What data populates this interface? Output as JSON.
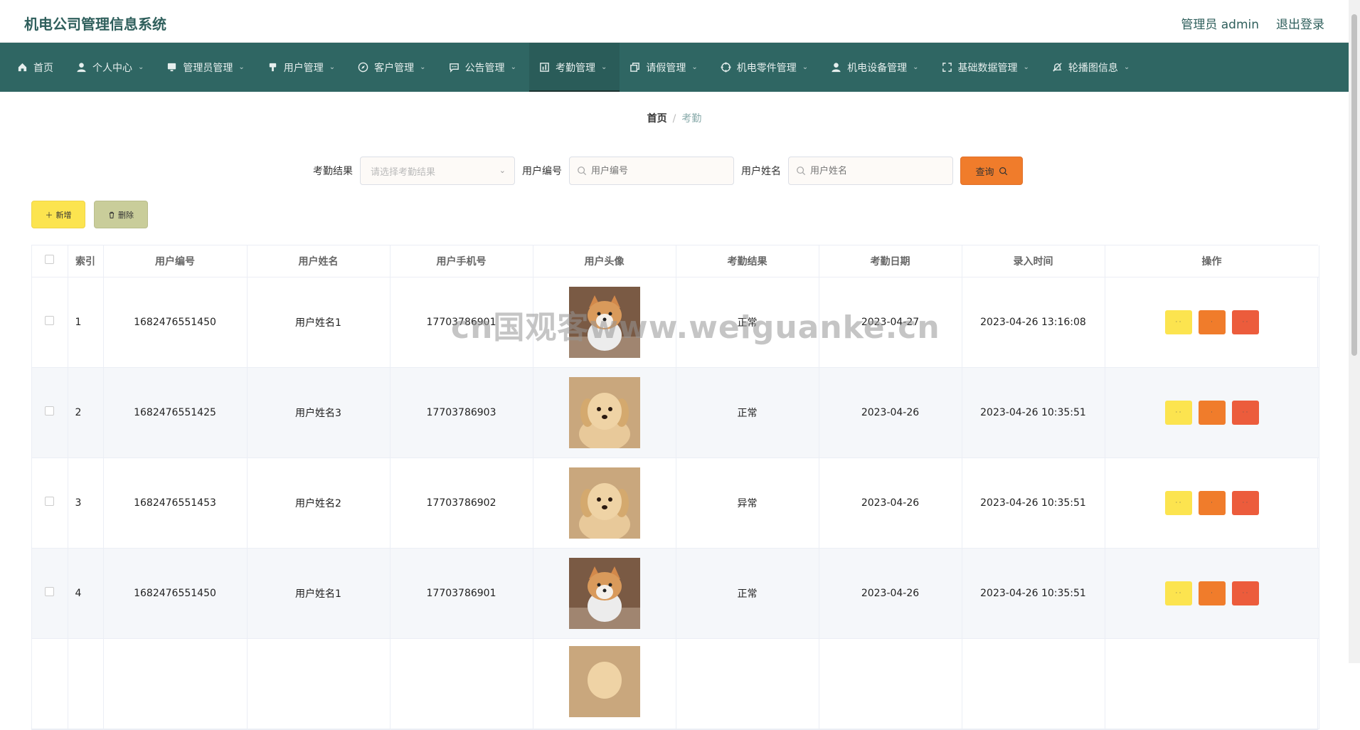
{
  "app": {
    "title": "机电公司管理信息系统",
    "user_label": "管理员 admin",
    "logout_label": "退出登录"
  },
  "nav": {
    "items": [
      {
        "label": "首页",
        "icon": "home-icon"
      },
      {
        "label": "个人中心",
        "icon": "user-icon"
      },
      {
        "label": "管理员管理",
        "icon": "monitor-icon"
      },
      {
        "label": "用户管理",
        "icon": "brush-icon"
      },
      {
        "label": "客户管理",
        "icon": "compass-icon"
      },
      {
        "label": "公告管理",
        "icon": "chat-icon"
      },
      {
        "label": "考勤管理",
        "icon": "chart-icon"
      },
      {
        "label": "请假管理",
        "icon": "copy-icon"
      },
      {
        "label": "机电零件管理",
        "icon": "target-icon"
      },
      {
        "label": "机电设备管理",
        "icon": "person-icon"
      },
      {
        "label": "基础数据管理",
        "icon": "fullscreen-icon"
      },
      {
        "label": "轮播图信息",
        "icon": "bell-off-icon"
      }
    ]
  },
  "breadcrumb": {
    "home": "首页",
    "current": "考勤"
  },
  "search": {
    "result_label": "考勤结果",
    "result_placeholder": "请选择考勤结果",
    "user_no_label": "用户编号",
    "user_no_placeholder": "用户编号",
    "user_name_label": "用户姓名",
    "user_name_placeholder": "用户姓名",
    "query_label": "查询"
  },
  "actions": {
    "add_label": "新增",
    "delete_label": "删除"
  },
  "table": {
    "headers": [
      "索引",
      "用户编号",
      "用户姓名",
      "用户手机号",
      "用户头像",
      "考勤结果",
      "考勤日期",
      "录入时间",
      "操作"
    ],
    "rows": [
      {
        "index": "1",
        "user_no": "1682476551450",
        "name": "用户姓名1",
        "phone": "17703786901",
        "avatar": "shiba",
        "result": "正常",
        "date": "2023-04-27",
        "created": "2023-04-26 13:16:08"
      },
      {
        "index": "2",
        "user_no": "1682476551425",
        "name": "用户姓名3",
        "phone": "17703786903",
        "avatar": "puppy",
        "result": "正常",
        "date": "2023-04-26",
        "created": "2023-04-26 10:35:51"
      },
      {
        "index": "3",
        "user_no": "1682476551453",
        "name": "用户姓名2",
        "phone": "17703786902",
        "avatar": "puppy",
        "result": "异常",
        "date": "2023-04-26",
        "created": "2023-04-26 10:35:51"
      },
      {
        "index": "4",
        "user_no": "1682476551450",
        "name": "用户姓名1",
        "phone": "17703786901",
        "avatar": "shiba",
        "result": "正常",
        "date": "2023-04-26",
        "created": "2023-04-26 10:35:51"
      }
    ],
    "op_labels": {
      "detail": "· ·",
      "edit": "·",
      "delete": "· ·"
    }
  },
  "watermark": "cn国观客www.weiguanke.cn",
  "colors": {
    "nav_bg": "#2f6663",
    "accent_orange": "#f07c2b",
    "accent_yellow": "#fce44f",
    "accent_red": "#ec5c3c",
    "delete_btn": "#c9cd9a"
  }
}
